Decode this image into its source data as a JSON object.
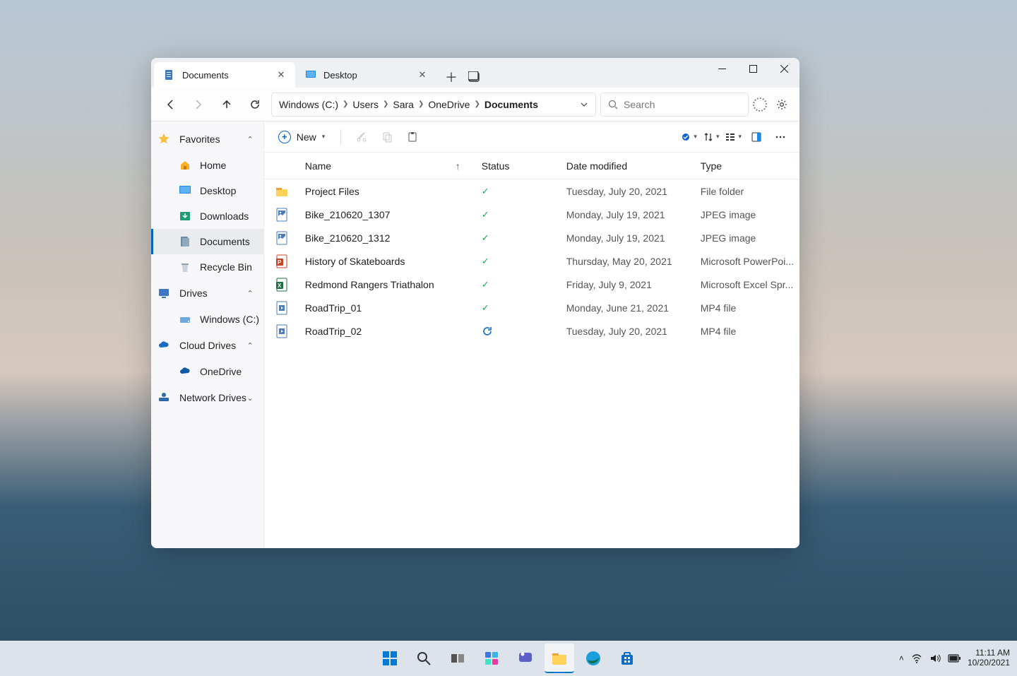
{
  "tabs": [
    {
      "label": "Documents",
      "active": true
    },
    {
      "label": "Desktop",
      "active": false
    }
  ],
  "breadcrumb": {
    "segments": [
      "Windows (C:)",
      "Users",
      "Sara",
      "OneDrive"
    ],
    "current": "Documents"
  },
  "search": {
    "placeholder": "Search"
  },
  "toolbar": {
    "new_label": "New"
  },
  "sidebar": {
    "groups": [
      {
        "label": "Favorites",
        "icon": "star",
        "expanded": true,
        "items": [
          {
            "label": "Home",
            "icon": "home"
          },
          {
            "label": "Desktop",
            "icon": "desktop"
          },
          {
            "label": "Downloads",
            "icon": "downloads"
          },
          {
            "label": "Documents",
            "icon": "documents",
            "selected": true
          },
          {
            "label": "Recycle Bin",
            "icon": "recycle"
          }
        ]
      },
      {
        "label": "Drives",
        "icon": "pc",
        "expanded": true,
        "items": [
          {
            "label": "Windows (C:)",
            "icon": "drive"
          }
        ]
      },
      {
        "label": "Cloud Drives",
        "icon": "cloud",
        "expanded": true,
        "items": [
          {
            "label": "OneDrive",
            "icon": "onedrive"
          }
        ]
      },
      {
        "label": "Network Drives",
        "icon": "network",
        "expanded": false,
        "items": []
      }
    ]
  },
  "columns": {
    "name": "Name",
    "status": "Status",
    "date": "Date modified",
    "type": "Type"
  },
  "files": [
    {
      "name": "Project Files",
      "icon": "folder",
      "status": "synced",
      "date": "Tuesday, July 20, 2021",
      "type": "File folder"
    },
    {
      "name": "Bike_210620_1307",
      "icon": "image",
      "status": "synced",
      "date": "Monday, July 19, 2021",
      "type": "JPEG image"
    },
    {
      "name": "Bike_210620_1312",
      "icon": "image",
      "status": "synced",
      "date": "Monday, July 19, 2021",
      "type": "JPEG image"
    },
    {
      "name": "History of Skateboards",
      "icon": "ppt",
      "status": "synced",
      "date": "Thursday, May 20, 2021",
      "type": "Microsoft PowerPoi..."
    },
    {
      "name": "Redmond Rangers Triathalon",
      "icon": "xls",
      "status": "synced",
      "date": "Friday, July 9, 2021",
      "type": "Microsoft Excel Spr..."
    },
    {
      "name": "RoadTrip_01",
      "icon": "video",
      "status": "synced",
      "date": "Monday, June 21, 2021",
      "type": "MP4 file"
    },
    {
      "name": "RoadTrip_02",
      "icon": "video",
      "status": "syncing",
      "date": "Tuesday, July 20, 2021",
      "type": "MP4 file"
    }
  ],
  "tray": {
    "time": "11:11 AM",
    "date": "10/20/2021"
  }
}
